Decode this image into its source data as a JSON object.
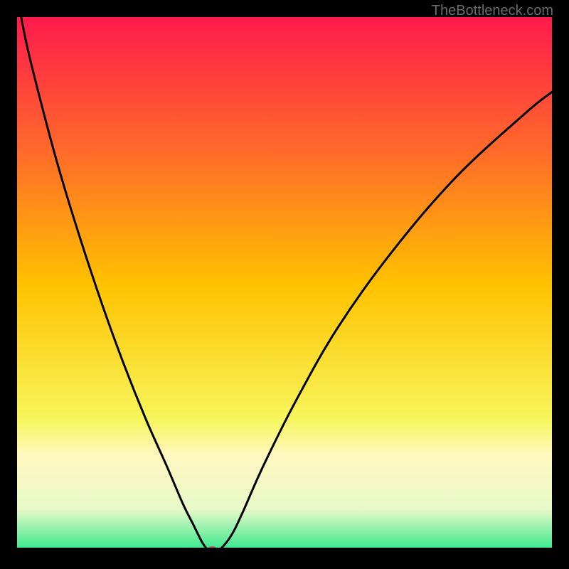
{
  "watermark": "TheBottleneck.com",
  "chart_data": {
    "type": "line",
    "title": "",
    "xlabel": "",
    "ylabel": "",
    "xlim": [
      0,
      100
    ],
    "ylim": [
      0,
      100
    ],
    "grid": false,
    "legend": false,
    "gradient": {
      "stops": [
        {
          "offset": 0,
          "color": "#ff1a4d"
        },
        {
          "offset": 25,
          "color": "#ff6a2a"
        },
        {
          "offset": 50,
          "color": "#ffc200"
        },
        {
          "offset": 75,
          "color": "#f7f55a"
        },
        {
          "offset": 82,
          "color": "#fff8c0"
        },
        {
          "offset": 92,
          "color": "#e8f9c8"
        },
        {
          "offset": 100,
          "color": "#2ee88a"
        }
      ]
    },
    "series": [
      {
        "name": "bottleneck-curve",
        "x": [
          0,
          2,
          5,
          8,
          12,
          16,
          20,
          24,
          28,
          31,
          33,
          34.5,
          35.5,
          36,
          37,
          38,
          40,
          42,
          46,
          52,
          60,
          70,
          82,
          95,
          100
        ],
        "y": [
          104,
          94,
          82,
          71,
          58,
          46,
          35,
          25,
          16,
          9,
          5,
          2,
          0.5,
          0,
          0,
          0.5,
          3,
          7,
          16,
          28,
          42,
          56,
          70,
          82,
          86
        ]
      }
    ],
    "marker": {
      "name": "optimum-point",
      "x": 36.5,
      "y": 0,
      "color": "#b05a48",
      "rx": 7,
      "ry": 5
    }
  }
}
